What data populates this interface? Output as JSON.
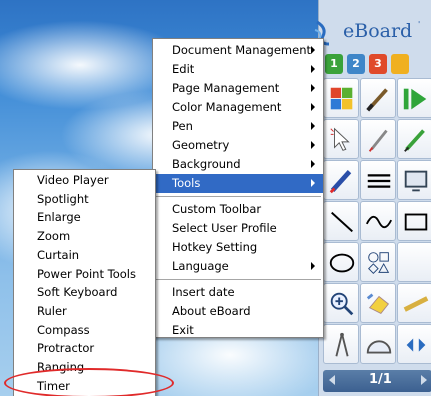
{
  "app": {
    "title": "eBoard",
    "page_counter": "1/1"
  },
  "toolbar": {
    "page_tabs": [
      {
        "label": "1",
        "color": "#3aa23a"
      },
      {
        "label": "2",
        "color": "#3f86c8"
      },
      {
        "label": "3",
        "color": "#e04a2a"
      },
      {
        "label": "",
        "color": "#f0b020"
      }
    ],
    "tools": [
      "windows-logo-icon",
      "brush-icon",
      "green-play-icon",
      "cursor-icon",
      "pen-icon",
      "green-pencil-icon",
      "red-marker-icon",
      "lines-icon",
      "display-icon",
      "line-icon",
      "wave-icon",
      "rectangle-icon",
      "ellipse-icon",
      "shapes-icon",
      "blank",
      "zoom-icon",
      "eraser-icon",
      "ruler-icon",
      "compass-icon",
      "protractor-icon",
      "arrows-icon"
    ]
  },
  "main_menu": {
    "items": [
      {
        "label": "Document Management",
        "submenu": true
      },
      {
        "label": "Edit",
        "submenu": true
      },
      {
        "label": "Page Management",
        "submenu": true
      },
      {
        "label": "Color Management",
        "submenu": true
      },
      {
        "label": "Pen",
        "submenu": true
      },
      {
        "label": "Geometry",
        "submenu": true
      },
      {
        "label": "Background",
        "submenu": true
      },
      {
        "label": "Tools",
        "submenu": true,
        "highlighted": true
      },
      {
        "label": "Custom Toolbar"
      },
      {
        "label": "Select User Profile"
      },
      {
        "label": "Hotkey Setting"
      },
      {
        "label": "Language",
        "submenu": true
      },
      {
        "label": "Insert date"
      },
      {
        "label": "About eBoard"
      },
      {
        "label": "Exit"
      }
    ]
  },
  "tools_submenu": {
    "items": [
      "Video Player",
      "Spotlight",
      "Enlarge",
      "Zoom",
      "Curtain",
      "Power Point Tools",
      "Soft Keyboard",
      "Ruler",
      "Compass",
      "Protractor",
      "Ranging",
      "Timer"
    ]
  },
  "colors": {
    "menu_highlight": "#316ac5",
    "annotation": "#e02a2a"
  }
}
